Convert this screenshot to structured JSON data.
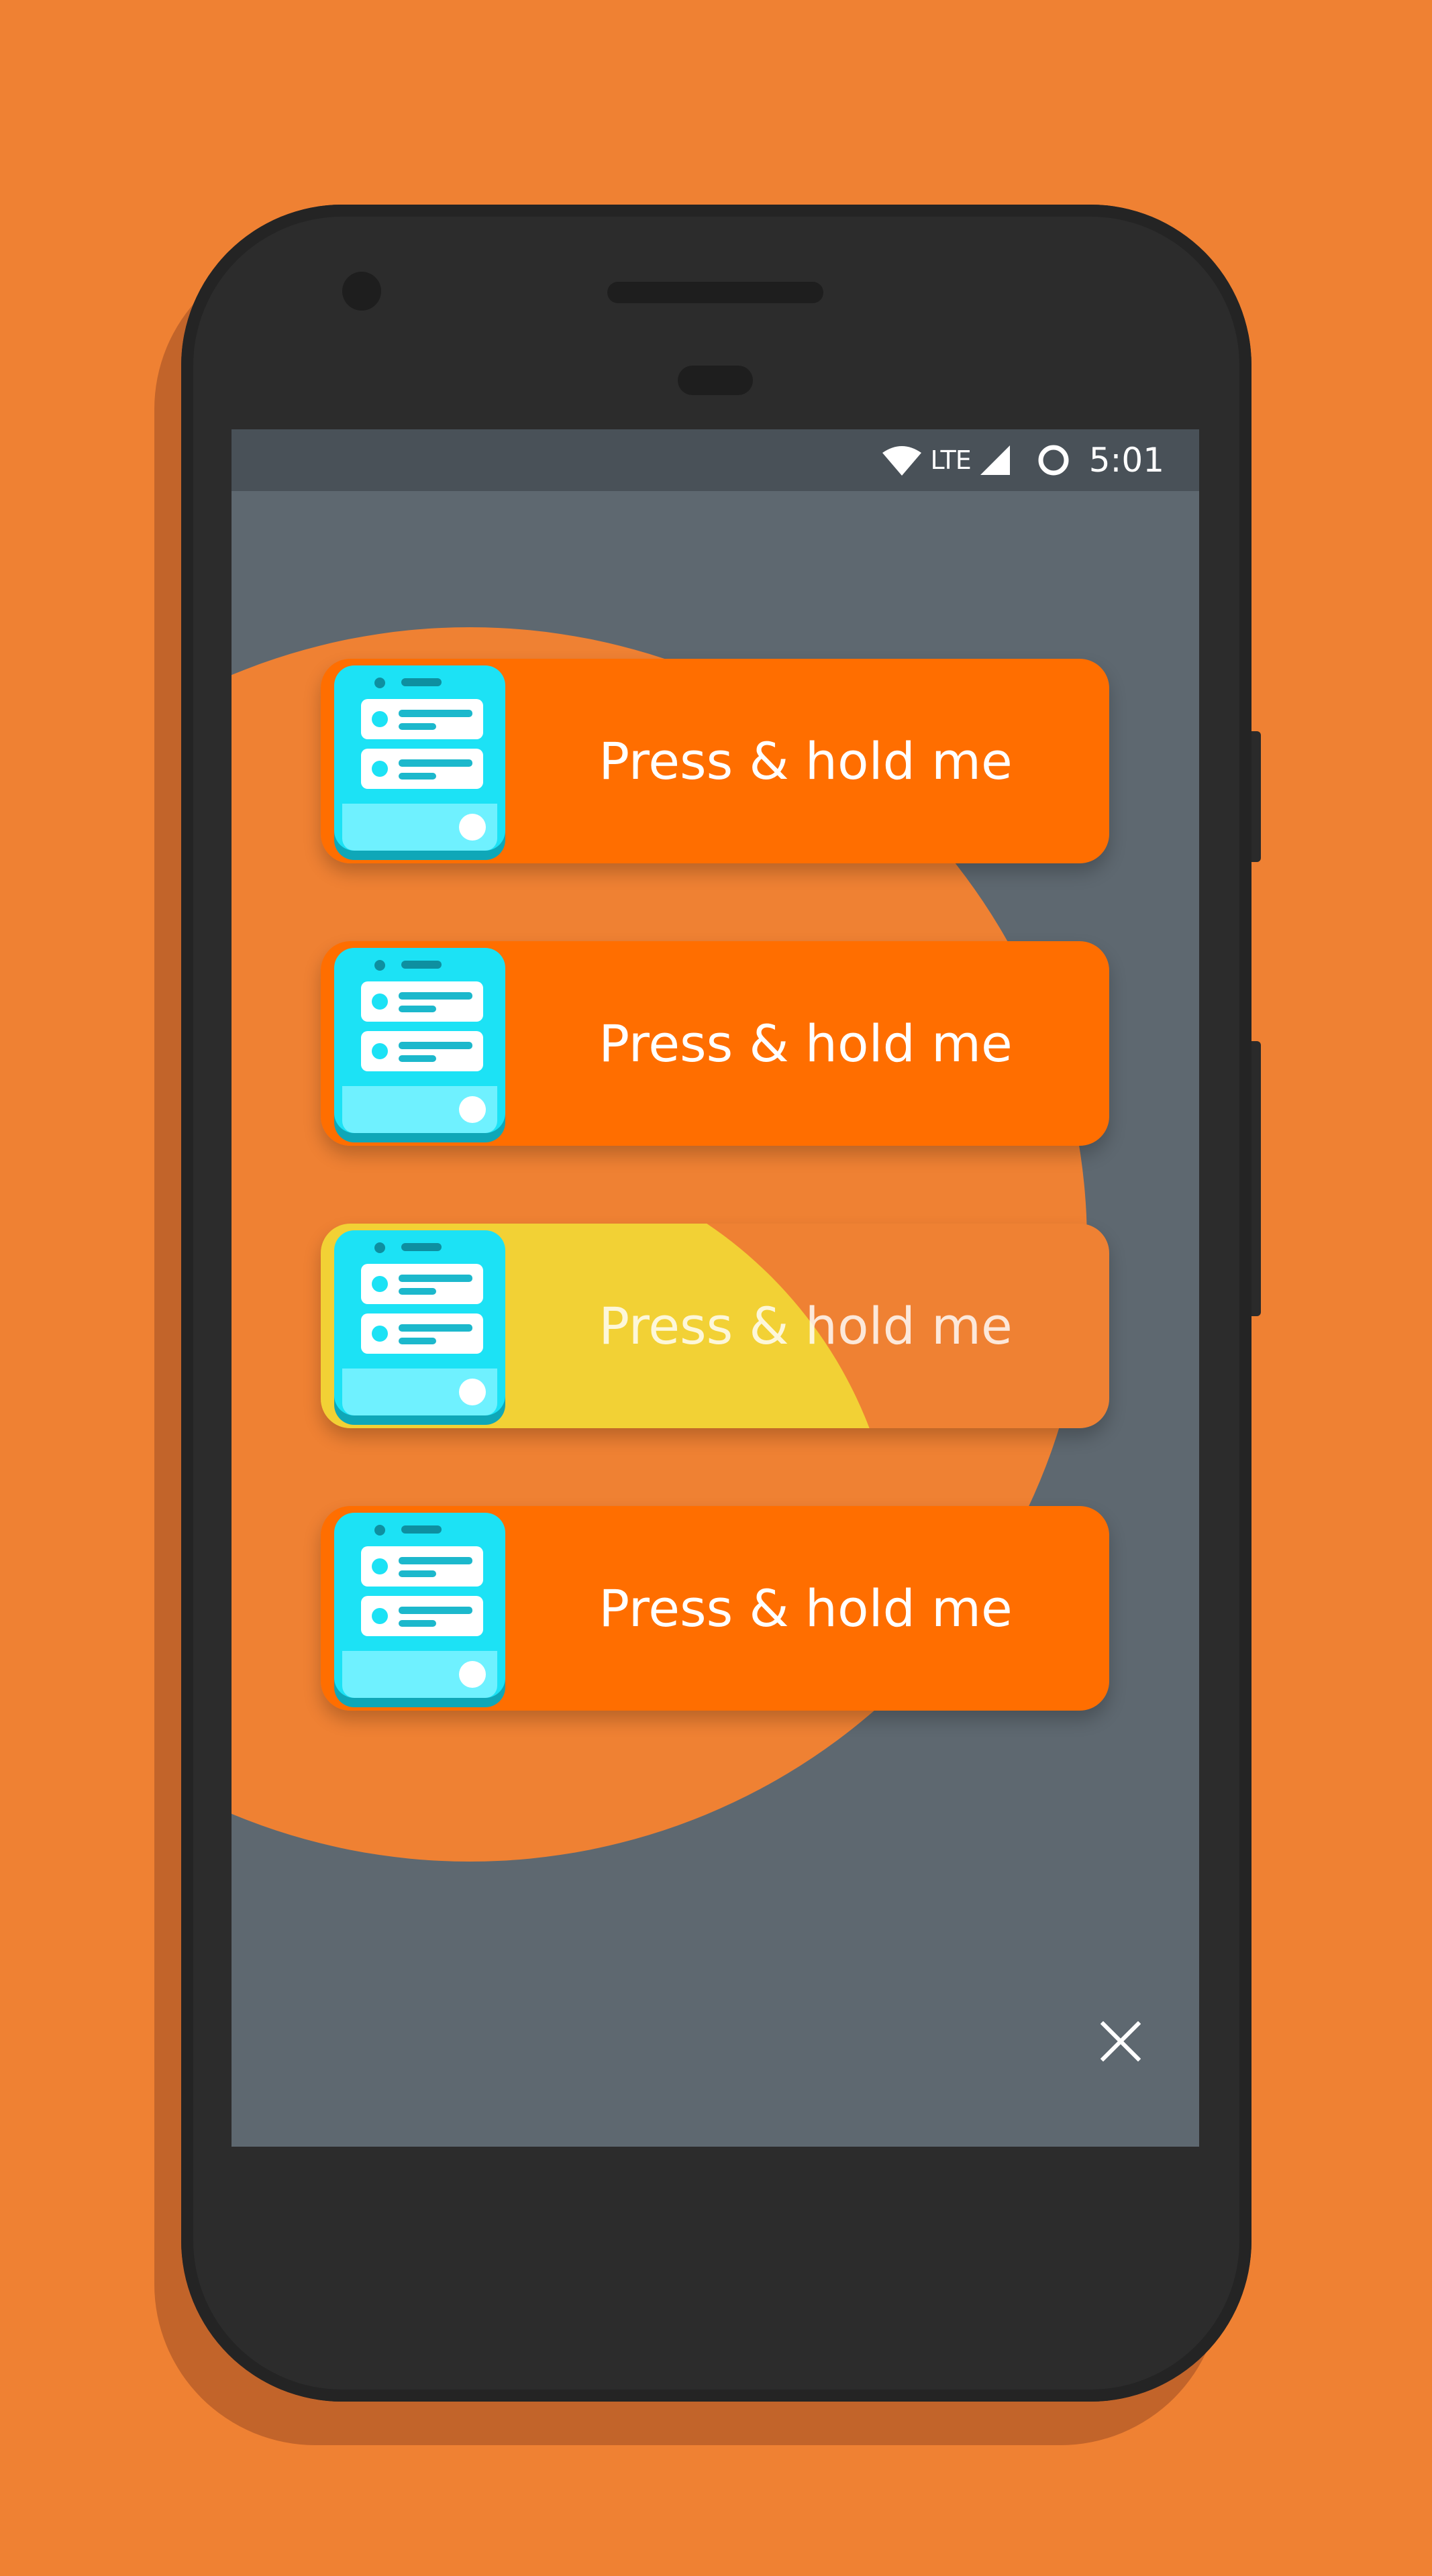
{
  "status_bar": {
    "network_label": "LTE",
    "time": "5:01",
    "icons": [
      "wifi-icon",
      "signal-icon",
      "circle-indicator-icon"
    ]
  },
  "cards": [
    {
      "label": "Press & hold me",
      "state": "idle",
      "icon": "app-drawer-icon"
    },
    {
      "label": "Press & hold me",
      "state": "idle",
      "icon": "app-drawer-icon"
    },
    {
      "label": "Press & hold me",
      "state": "pressed",
      "icon": "app-drawer-icon"
    },
    {
      "label": "Press & hold me",
      "state": "idle",
      "icon": "app-drawer-icon"
    }
  ],
  "close_button": {
    "icon": "close-icon"
  },
  "colors": {
    "page_background": "#EF8133",
    "screen_background": "#5E6870",
    "status_bar": "#495158",
    "card_idle": "#FF6E00",
    "card_pressed_base": "#EF8133",
    "press_ripple": "#F2D135",
    "icon_cyan": "#1CE2F5",
    "text": "#FFFFFF"
  }
}
